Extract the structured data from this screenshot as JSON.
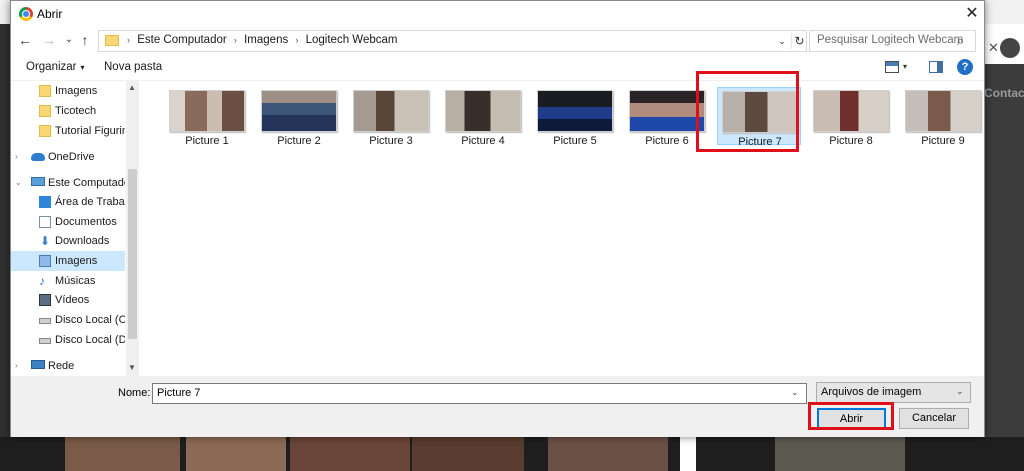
{
  "dialog": {
    "title": "Abrir",
    "close_glyph": "✕"
  },
  "nav": {
    "back": "←",
    "forward": "→",
    "recent": "⌄",
    "up": "↑"
  },
  "address": {
    "breadcrumb": [
      "Este Computador",
      "Imagens",
      "Logitech Webcam"
    ],
    "separator": "›",
    "dropdown_glyph": "⌄",
    "refresh_glyph": "↻"
  },
  "search": {
    "placeholder": "Pesquisar Logitech Webcam",
    "icon_glyph": "⌕"
  },
  "toolbar": {
    "organize": "Organizar",
    "new_folder": "Nova pasta",
    "help": "?",
    "caret": "▾"
  },
  "sidebar": {
    "items": [
      {
        "label": "Imagens",
        "icon": "folder-icon",
        "indent": 2
      },
      {
        "label": "Ticotech",
        "icon": "folder-icon",
        "indent": 2
      },
      {
        "label": "Tutorial Figurinhas",
        "icon": "folder-icon",
        "indent": 2
      },
      {
        "label": "OneDrive",
        "icon": "cloud-icon",
        "indent": 1
      },
      {
        "label": "Este Computador",
        "icon": "computer-icon",
        "indent": 1
      },
      {
        "label": "Área de Trabalho",
        "icon": "desktop-icon",
        "indent": 2
      },
      {
        "label": "Documentos",
        "icon": "documents-icon",
        "indent": 2
      },
      {
        "label": "Downloads",
        "icon": "download-icon",
        "indent": 2
      },
      {
        "label": "Imagens",
        "icon": "pictures-icon",
        "indent": 2,
        "selected": true
      },
      {
        "label": "Músicas",
        "icon": "music-icon",
        "indent": 2
      },
      {
        "label": "Vídeos",
        "icon": "videos-icon",
        "indent": 2
      },
      {
        "label": "Disco Local (C:)",
        "icon": "drive-icon",
        "indent": 2
      },
      {
        "label": "Disco Local (D:)",
        "icon": "drive-icon",
        "indent": 2
      },
      {
        "label": "Rede",
        "icon": "network-icon",
        "indent": 1
      }
    ]
  },
  "files": [
    {
      "name": "Picture 1"
    },
    {
      "name": "Picture 2"
    },
    {
      "name": "Picture 3"
    },
    {
      "name": "Picture 4"
    },
    {
      "name": "Picture 5"
    },
    {
      "name": "Picture 6"
    },
    {
      "name": "Picture 7",
      "selected": true
    },
    {
      "name": "Picture 8"
    },
    {
      "name": "Picture 9"
    }
  ],
  "bottom": {
    "name_label": "Nome:",
    "name_value": "Picture 7",
    "file_type": "Arquivos de imagem",
    "open": "Abrir",
    "cancel": "Cancelar"
  },
  "background": {
    "contact_text": "Contact"
  },
  "colors": {
    "highlight": "#e0101b",
    "selection": "#cce8ff",
    "accent": "#0078d7"
  }
}
